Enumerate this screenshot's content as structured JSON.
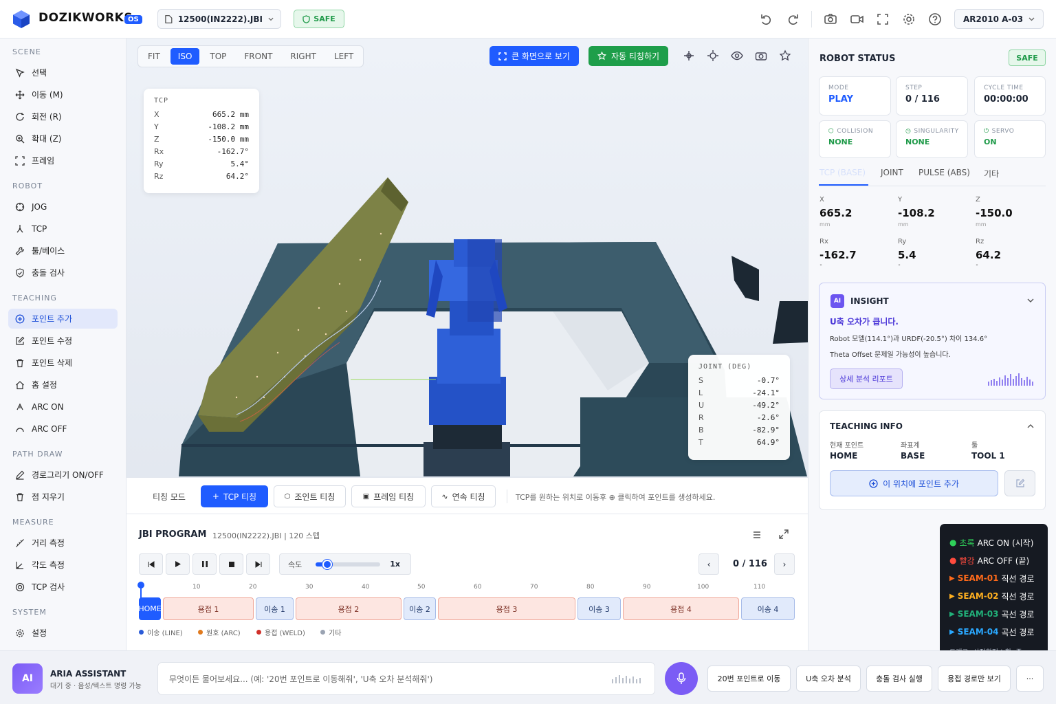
{
  "header": {
    "brand": "DOZIKWORKS",
    "os_badge": "OS",
    "file": "12500(IN2222).JBI",
    "safe": "SAFE",
    "robot": "AR2010 A-03"
  },
  "sidebar": {
    "sections": {
      "scene": "SCENE",
      "robot": "ROBOT",
      "teaching": "TEACHING",
      "path_draw": "PATH DRAW",
      "measure": "MEASURE",
      "system": "SYSTEM"
    },
    "items": {
      "select": "선택",
      "move": "이동 (M)",
      "rotate": "회전 (R)",
      "zoom": "확대 (Z)",
      "frame": "프레임",
      "jog": "JOG",
      "tcp": "TCP",
      "tool_base": "툴/베이스",
      "collision": "충돌 검사",
      "point_add": "포인트 추가",
      "point_edit": "포인트 수정",
      "point_delete": "포인트 삭제",
      "home_set": "홈 설정",
      "arc_on": "ARC ON",
      "arc_off": "ARC OFF",
      "path_toggle": "경로그리기 ON/OFF",
      "erase_points": "점 지우기",
      "distance": "거리 측정",
      "angle": "각도 측정",
      "tcp_check": "TCP 검사",
      "settings": "설정"
    }
  },
  "viewport": {
    "view_tabs": [
      "FIT",
      "ISO",
      "TOP",
      "FRONT",
      "RIGHT",
      "LEFT"
    ],
    "active_view": "ISO",
    "fullscreen_label": "큰 화면으로 보기",
    "auto_teach_label": "자동 티칭하기",
    "tcp_panel": {
      "title": "TCP",
      "rows": [
        {
          "k": "X",
          "v": "665.2 mm"
        },
        {
          "k": "Y",
          "v": "-108.2 mm"
        },
        {
          "k": "Z",
          "v": "-150.0 mm"
        },
        {
          "k": "Rx",
          "v": "-162.7°"
        },
        {
          "k": "Ry",
          "v": "5.4°"
        },
        {
          "k": "Rz",
          "v": "64.2°"
        }
      ]
    },
    "joint_panel": {
      "title": "JOINT (DEG)",
      "rows": [
        {
          "k": "S",
          "v": "-0.7°"
        },
        {
          "k": "L",
          "v": "-24.1°"
        },
        {
          "k": "U",
          "v": "-49.2°"
        },
        {
          "k": "R",
          "v": "-2.6°"
        },
        {
          "k": "B",
          "v": "-82.9°"
        },
        {
          "k": "T",
          "v": "64.9°"
        }
      ]
    }
  },
  "teach_bar": {
    "label": "티칭 모드",
    "tcp": "TCP 티칭",
    "joint": "조인트 티칭",
    "frame": "프레임 티칭",
    "continuous": "연속 티칭",
    "hint": "TCP를 원하는 위치로 이동후 ⊕ 클릭하여 포인트를 생성하세요."
  },
  "jbi": {
    "title": "JBI PROGRAM",
    "subtitle": "12500(IN2222).JBI | 120 스텝",
    "speed_label": "속도",
    "speed_value": "1x",
    "speed_fraction": 0.18,
    "step": "0 / 116",
    "ticks": [
      "10",
      "20",
      "30",
      "40",
      "50",
      "60",
      "70",
      "80",
      "90",
      "100",
      "110"
    ],
    "segments": [
      {
        "label": "HOME",
        "type": "home"
      },
      {
        "label": "용접 1",
        "type": "weld"
      },
      {
        "label": "이송 1",
        "type": "move"
      },
      {
        "label": "용접 2",
        "type": "weld"
      },
      {
        "label": "이송 2",
        "type": "move"
      },
      {
        "label": "용접 3",
        "type": "weld"
      },
      {
        "label": "이송 3",
        "type": "move"
      },
      {
        "label": "용접 4",
        "type": "weld"
      },
      {
        "label": "이송 4",
        "type": "move"
      }
    ],
    "legend": [
      {
        "label": "이송 (LINE)",
        "color": "#2a5bd7"
      },
      {
        "label": "원호 (ARC)",
        "color": "#e07a1e"
      },
      {
        "label": "용접 (WELD)",
        "color": "#d0302a"
      },
      {
        "label": "기타",
        "color": "#9aa3b2"
      }
    ]
  },
  "right": {
    "status_title": "ROBOT STATUS",
    "safe": "SAFE",
    "mode_label": "MODE",
    "mode_value": "PLAY",
    "step_label": "STEP",
    "step_value": "0 / 116",
    "cycle_label": "CYCLE TIME",
    "cycle_value": "00:00:00",
    "collision_label": "COLLISION",
    "collision_value": "NONE",
    "singularity_label": "SINGULARITY",
    "singularity_value": "NONE",
    "servo_label": "SERVO",
    "servo_value": "ON",
    "tabs": [
      "TCP (BASE)",
      "JOINT",
      "PULSE (ABS)",
      "기타"
    ],
    "coords": [
      {
        "k": "X",
        "v": "665.2",
        "u": "mm"
      },
      {
        "k": "Y",
        "v": "-108.2",
        "u": "mm"
      },
      {
        "k": "Z",
        "v": "-150.0",
        "u": "mm"
      },
      {
        "k": "Rx",
        "v": "-162.7",
        "u": "°"
      },
      {
        "k": "Ry",
        "v": "5.4",
        "u": "°"
      },
      {
        "k": "Rz",
        "v": "64.2",
        "u": "°"
      }
    ],
    "insight": {
      "badge": "AI",
      "title": "INSIGHT",
      "headline": "U축 오차가 큽니다.",
      "line1": "Robot 모델(114.1°)과 URDF(-20.5°) 차이 134.6°",
      "line2": "Theta Offset 문제일 가능성이 높습니다.",
      "button": "상세 분석 리포트"
    },
    "teaching_info": {
      "title": "TEACHING INFO",
      "current_label": "현재 포인트",
      "current_value": "HOME",
      "coord_label": "좌표계",
      "coord_value": "BASE",
      "tool_label": "툴",
      "tool_value": "TOOL 1",
      "add_button": "이 위치에 포인트 추가"
    }
  },
  "seam_legend": {
    "rows": [
      {
        "mark": "●",
        "color": "#2fd05a",
        "label": "초록",
        "text": "ARC ON (시작)"
      },
      {
        "mark": "●",
        "color": "#ff4b3e",
        "label": "빨강",
        "text": "ARC OFF (끝)"
      },
      {
        "mark": "▶",
        "color": "#ff6a1a",
        "label": "SEAM-01",
        "text": "직선 경로"
      },
      {
        "mark": "▶",
        "color": "#ffb020",
        "label": "SEAM-02",
        "text": "직선 경로"
      },
      {
        "mark": "▶",
        "color": "#21b27a",
        "label": "SEAM-03",
        "text": "곡선 경로"
      },
      {
        "mark": "▶",
        "color": "#2aa8ff",
        "label": "SEAM-04",
        "text": "곡선 경로"
      }
    ],
    "footer": "드래그: 시점회전 | 휠: 줌"
  },
  "assistant": {
    "avatar": "AI",
    "name": "ARIA ASSISTANT",
    "status": "대기 중 · 음성/텍스트 명령 가능",
    "placeholder": "무엇이든 물어보세요... (예: '20번 포인트로 이동해줘', 'U축 오차 분석해줘')",
    "quick": [
      "20번 포인트로 이동",
      "U축 오차 분석",
      "충돌 검사 실행",
      "용접 경로만 보기"
    ],
    "more": "···"
  }
}
